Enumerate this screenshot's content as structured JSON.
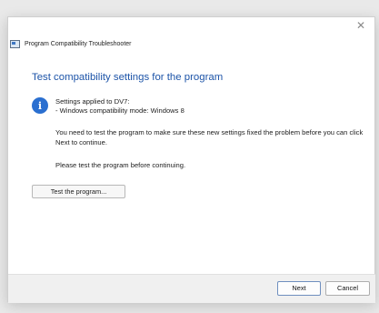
{
  "window": {
    "title": "Program Compatibility Troubleshooter",
    "close_glyph": "✕"
  },
  "main": {
    "heading": "Test compatibility settings for the program",
    "info_icon": "info-icon",
    "settings_applied": "Settings applied to DV7:",
    "compat_mode": "- Windows compatibility mode: Windows 8",
    "instruction": "You need to test the program to make sure these new settings fixed the problem before you can click Next to continue.",
    "test_prompt": "Please test the program before continuing.",
    "test_button_label": "Test the program..."
  },
  "footer": {
    "next_label": "Next",
    "cancel_label": "Cancel"
  },
  "colors": {
    "heading": "#1d54a8",
    "info_icon": "#2a6fd0"
  }
}
